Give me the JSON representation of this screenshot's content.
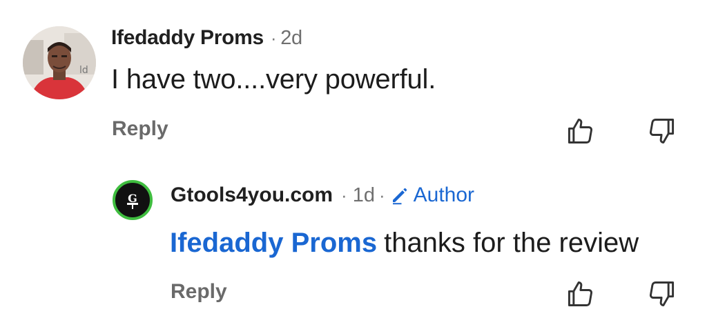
{
  "comments": [
    {
      "author": "Ifedaddy Proms",
      "separator": "·",
      "time": "2d",
      "text": "I have two....very powerful.",
      "reply_label": "Reply"
    },
    {
      "author": "Gtools4you.com",
      "separator": "·",
      "time": "1d",
      "badge": "Author",
      "mention": "Ifedaddy Proms",
      "text": "thanks for the review",
      "reply_label": "Reply",
      "avatar_ring_color": "#3fbd3f"
    }
  ],
  "colors": {
    "link_blue": "#1a67d2",
    "muted_gray": "#6a6a6a"
  },
  "icons": {
    "like": "thumbs-up-icon",
    "dislike": "thumbs-down-icon",
    "author": "pencil-icon"
  }
}
